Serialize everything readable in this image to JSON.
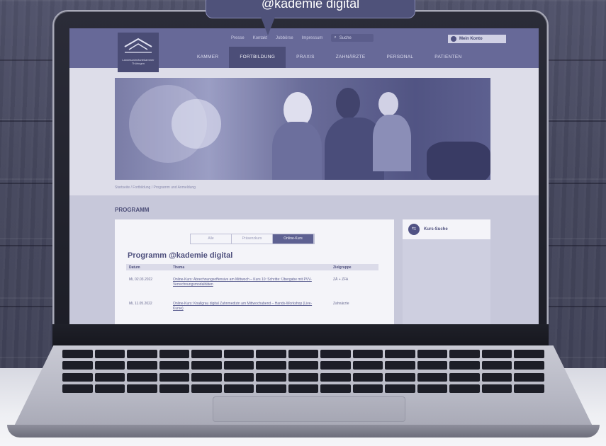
{
  "callout": {
    "text": "@kademie digital"
  },
  "site": {
    "logo_text": "Landeszahnärztekammer Thüringen",
    "topbar": [
      "Presse",
      "Kontakt",
      "Jobbörse",
      "Impressum"
    ],
    "search_placeholder": "Suche",
    "login_label": "Mein Konto",
    "nav": [
      "KAMMER",
      "FORTBILDUNG",
      "PRAXIS",
      "ZAHNÄRZTE",
      "PERSONAL",
      "PATIENTEN"
    ],
    "active_nav": "FORTBILDUNG",
    "breadcrumb": "Startseite / Fortbildung / Programm und Anmeldung",
    "section_title": "PROGRAMM",
    "filters": [
      "Alle",
      "Präsenzkurs",
      "Online-Kurs"
    ],
    "active_filter": "Online-Kurs",
    "program_title": "Programm @kademie digital",
    "table_headers": [
      "Datum",
      "Thema",
      "Zielgruppe"
    ],
    "rows": [
      {
        "date": "Mi, 02.03.2022",
        "topic": "Online-Kurs: Abrechnungsoffensive am Mittwoch – Kurs 10: Schritte: Übergabe mit PVV-Verrechnungsmodalitäten",
        "group": "ZÄ + ZFA"
      },
      {
        "date": "Mi, 11.05.2022",
        "topic": "Online-Kurs: Knallgrau digital Zahnmedizin am Mittwochabend – Hands-Workshop (Live-Kurse)",
        "group": "Zahnärzte"
      }
    ],
    "sidebar_label": "Kurs-Suche"
  }
}
